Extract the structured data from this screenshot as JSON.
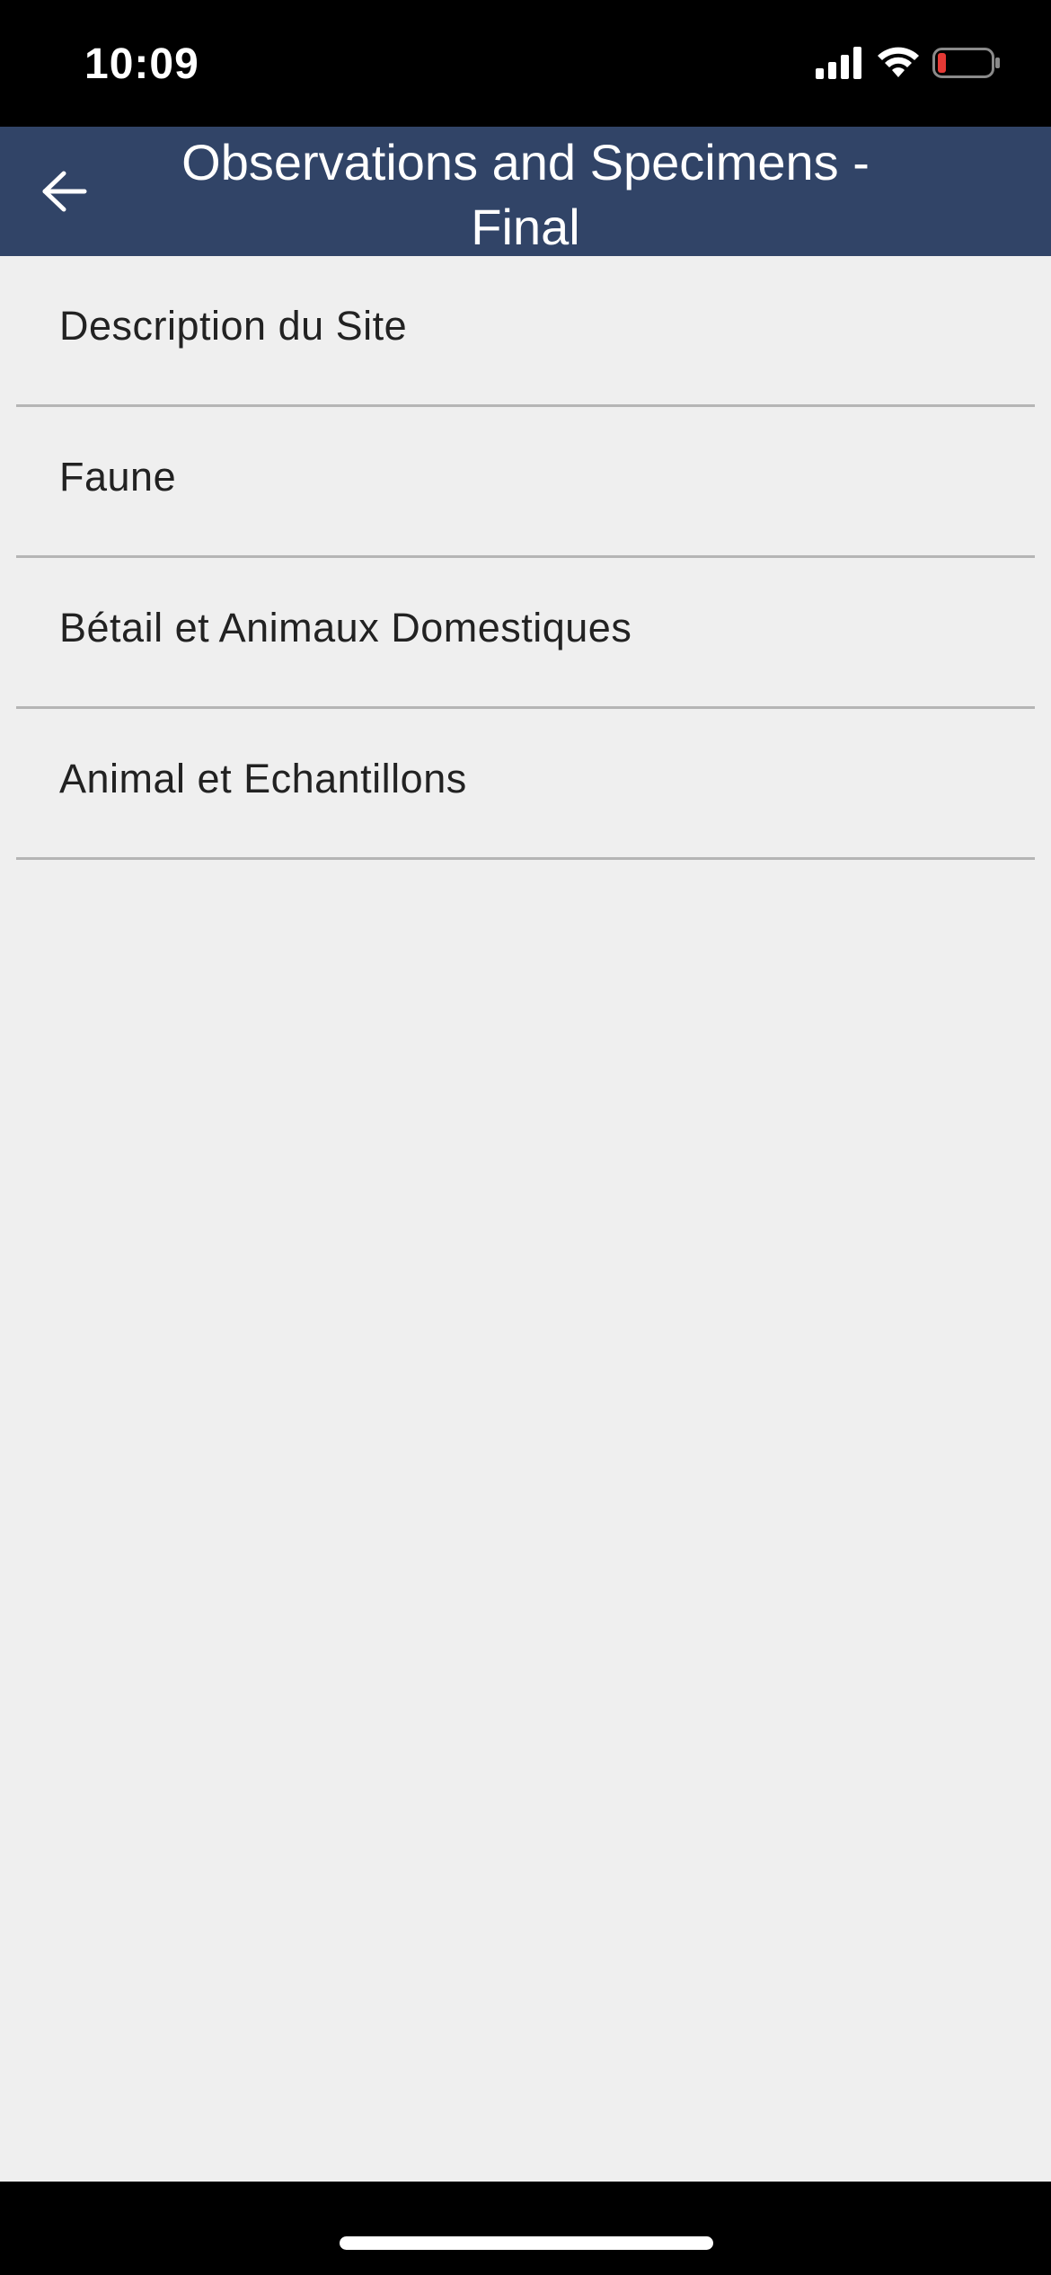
{
  "status_bar": {
    "time": "10:09",
    "icons": [
      "signal-icon",
      "wifi-icon",
      "battery-low-icon"
    ],
    "battery_color": "#e53935"
  },
  "header": {
    "title": "Observations and Specimens - Final",
    "back_icon": "arrow-left-icon",
    "background_color": "#314467"
  },
  "menu": {
    "items": [
      {
        "label": "Description du Site"
      },
      {
        "label": "Faune"
      },
      {
        "label": "Bétail et Animaux Domestiques"
      },
      {
        "label": "Animal et Echantillons"
      }
    ]
  }
}
